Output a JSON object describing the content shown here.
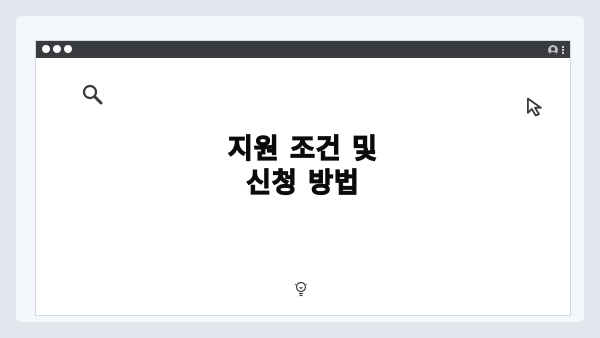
{
  "window": {
    "controls": [
      "close",
      "minimize",
      "maximize"
    ],
    "titlebar_color": "#3a3b3f"
  },
  "page": {
    "title_line1": "지원 조건 및",
    "title_line2": "신청 방법"
  },
  "icons": {
    "search": "search-icon",
    "cursor": "cursor-arrow-icon",
    "lightbulb": "lightbulb-icon",
    "profile": "profile-icon",
    "menu": "kebab-menu-icon"
  },
  "colors": {
    "background": "#e3e8ef",
    "text": "#0b0b0b"
  }
}
